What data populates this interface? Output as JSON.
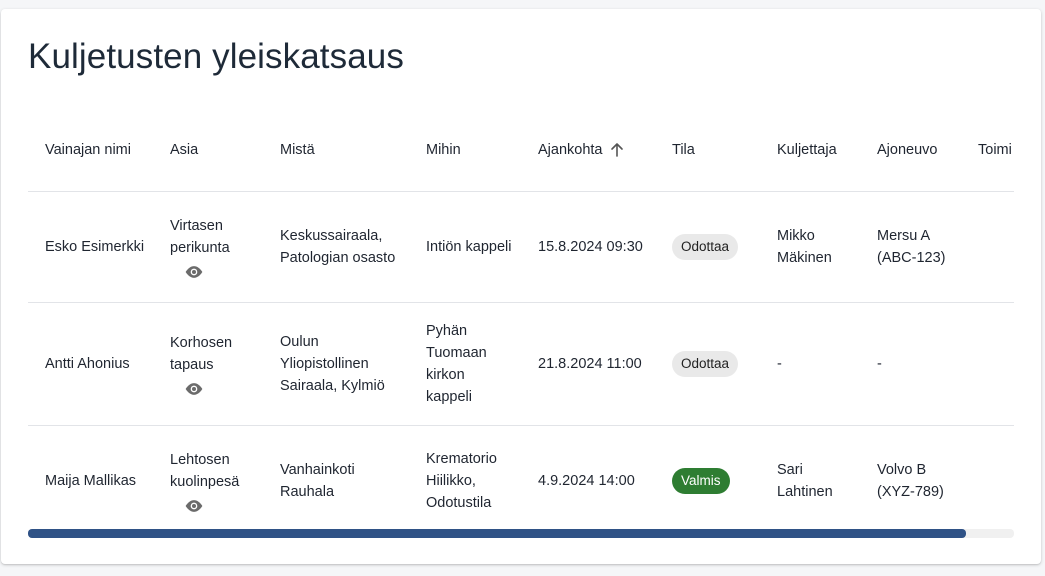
{
  "page": {
    "title": "Kuljetusten yleiskatsaus"
  },
  "table": {
    "columns": [
      {
        "label": "Vainajan nimi"
      },
      {
        "label": "Asia"
      },
      {
        "label": "Mistä"
      },
      {
        "label": "Mihin"
      },
      {
        "label": "Ajankohta",
        "sorted": "ascending"
      },
      {
        "label": "Tila"
      },
      {
        "label": "Kuljettaja"
      },
      {
        "label": "Ajoneuvo"
      },
      {
        "label": "Toimi"
      }
    ],
    "rows": [
      {
        "name": "Esko Esimerkki",
        "case": "Virtasen perikunta",
        "from": "Keskussairaala, Patologian osasto",
        "to": "Intiön kappeli",
        "time": "15.8.2024 09:30",
        "status": "Odottaa",
        "status_kind": "pending",
        "driver": "Mikko Mäkinen",
        "vehicle": "Mersu A (ABC-123)"
      },
      {
        "name": "Antti Ahonius",
        "case": "Korhosen tapaus",
        "from": "Oulun Yliopistollinen Sairaala, Kylmiö",
        "to": "Pyhän Tuomaan kirkon kappeli",
        "time": "21.8.2024 11:00",
        "status": "Odottaa",
        "status_kind": "pending",
        "driver": "-",
        "vehicle": "-"
      },
      {
        "name": "Maija Mallikas",
        "case": "Lehtosen kuolinpesä",
        "from": "Vanhainkoti Rauhala",
        "to": "Krematorio Hiilikko, Odotustila",
        "time": "4.9.2024 14:00",
        "status": "Valmis",
        "status_kind": "done",
        "driver": "Sari Lahtinen",
        "vehicle": "Volvo B (XYZ-789)"
      }
    ]
  },
  "scrollbar": {
    "position_fraction": 0.0,
    "visible_fraction": 0.951
  },
  "colors": {
    "title": "#1e2a38",
    "status_pending_bg": "#e9e9e9",
    "status_done_bg": "#2e7d32",
    "scrollbar_thumb": "#2f5286"
  },
  "icons": {
    "view": "eye-icon",
    "sort": "arrow-up-icon"
  }
}
